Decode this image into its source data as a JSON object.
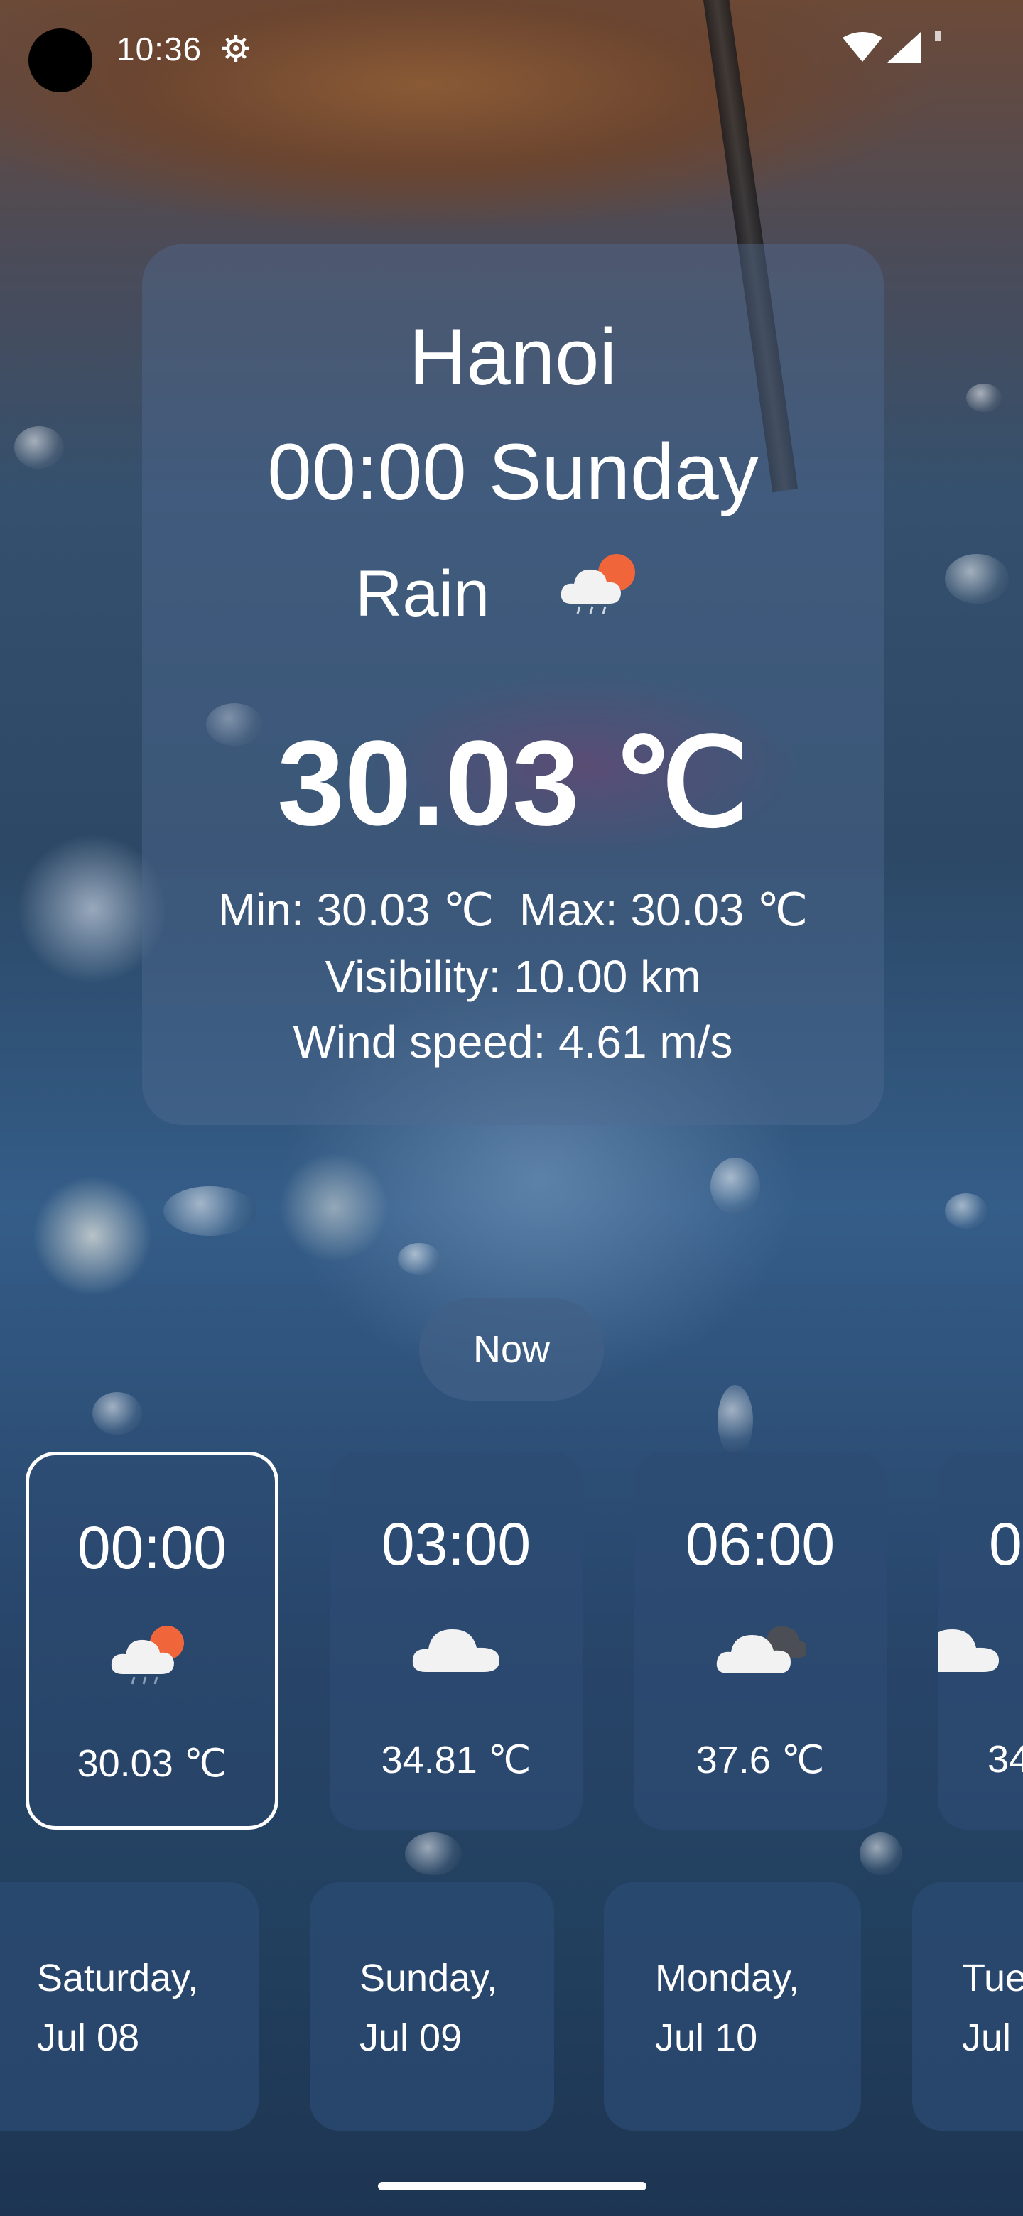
{
  "status_bar": {
    "time": "10:36"
  },
  "current": {
    "city": "Hanoi",
    "datetime": "00:00 Sunday",
    "condition": "Rain",
    "condition_icon": "cloud-sun-rain-icon",
    "temperature": "30.03 ℃",
    "min_max": "Min: 30.03 ℃  Max: 30.03 ℃",
    "visibility": "Visibility: 10.00 km",
    "wind_speed": "Wind speed: 4.61 m/s"
  },
  "now_button": {
    "label": "Now"
  },
  "hourly": [
    {
      "time": "00:00",
      "icon": "cloud-sun-rain-icon",
      "temp": "30.03 ℃",
      "selected": true
    },
    {
      "time": "03:00",
      "icon": "cloud-icon",
      "temp": "34.81 ℃"
    },
    {
      "time": "06:00",
      "icon": "cloud-dark-icon",
      "temp": "37.6 ℃"
    },
    {
      "time": "0",
      "icon": "cloud-icon",
      "temp": "34"
    }
  ],
  "daily": [
    {
      "line1": "Saturday,",
      "line2": "Jul 08"
    },
    {
      "line1": "Sunday,",
      "line2": "Jul 09"
    },
    {
      "line1": "Monday,",
      "line2": "Jul 10"
    },
    {
      "line1": "Tue",
      "line2": "Jul"
    }
  ]
}
